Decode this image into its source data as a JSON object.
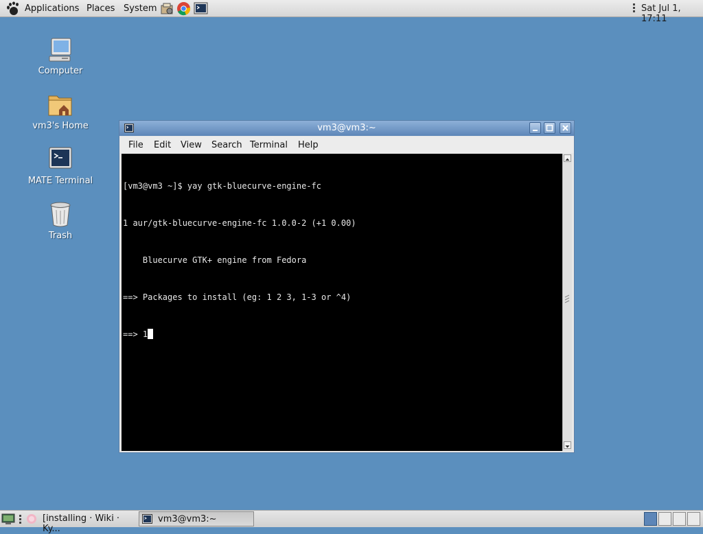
{
  "top_panel": {
    "menus": [
      "Applications",
      "Places",
      "System"
    ],
    "launchers": [
      "package-manager-icon",
      "chrome-icon",
      "terminal-launcher-icon"
    ],
    "clock": "Sat Jul  1, 17:11"
  },
  "desktop": {
    "icons": [
      {
        "label": "Computer",
        "icon": "computer-icon"
      },
      {
        "label": "vm3's Home",
        "icon": "home-folder-icon"
      },
      {
        "label": "MATE Terminal",
        "icon": "terminal-icon"
      },
      {
        "label": "Trash",
        "icon": "trash-icon"
      }
    ]
  },
  "window": {
    "title": "vm3@vm3:~",
    "menu": [
      "File",
      "Edit",
      "View",
      "Search",
      "Terminal",
      "Help"
    ],
    "lines": [
      "[vm3@vm3 ~]$ yay gtk-bluecurve-engine-fc",
      "1 aur/gtk-bluecurve-engine-fc 1.0.0-2 (+1 0.00)",
      "    Bluecurve GTK+ engine from Fedora",
      "==> Packages to install (eg: 1 2 3, 1-3 or ^4)",
      "==> 1"
    ]
  },
  "taskbar": {
    "tasks": [
      {
        "label": "[installing · Wiki · Ky...",
        "icon": "browser-icon",
        "active": false
      },
      {
        "label": "vm3@vm3:~",
        "icon": "terminal-icon",
        "active": true
      }
    ],
    "workspaces": 4,
    "current_workspace": 1
  },
  "colors": {
    "desktop_bg": "#5b8fbe",
    "titlebar": "#6e96c8",
    "terminal_bg": "#000000",
    "terminal_fg": "#e8e8e8"
  }
}
